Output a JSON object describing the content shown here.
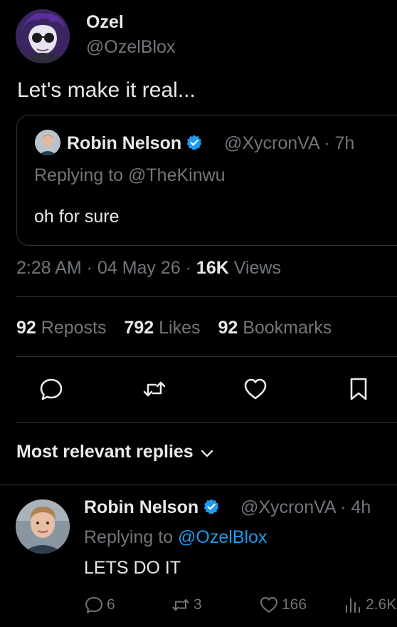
{
  "tweet": {
    "author_name": "Ozel",
    "author_handle": "@OzelBlox",
    "text": "Let's make it real...",
    "time": "2:28 AM",
    "date": "04 May 26",
    "views_count": "16K",
    "views_label": "Views",
    "reposts_count": "92",
    "reposts_label": "Reposts",
    "likes_count": "792",
    "likes_label": "Likes",
    "bookmarks_count": "92",
    "bookmarks_label": "Bookmarks"
  },
  "quote": {
    "author_name": "Robin Nelson",
    "author_handle": "@XycronVA",
    "time_ago": "7h",
    "replying_prefix": "Replying to",
    "replying_to": "@TheKinwu",
    "text": "oh for sure"
  },
  "replies_header": "Most relevant replies",
  "reply": {
    "author_name": "Robin Nelson",
    "author_handle": "@XycronVA",
    "time_ago": "4h",
    "replying_prefix": "Replying to",
    "replying_to": "@OzelBlox",
    "text": "LETS DO IT",
    "reply_count": "6",
    "repost_count": "3",
    "like_count": "166",
    "view_count": "2.6K"
  },
  "colors": {
    "background": "#000000",
    "text": "#e7e9ea",
    "muted": "#71767b",
    "accent": "#1d9bf0",
    "border": "#2f3336"
  },
  "icons": {
    "reply": "reply-icon",
    "repost": "repost-icon",
    "like": "heart-icon",
    "bookmark": "bookmark-icon",
    "views": "views-icon",
    "verified": "verified-badge-icon",
    "chevron": "chevron-down-icon"
  }
}
